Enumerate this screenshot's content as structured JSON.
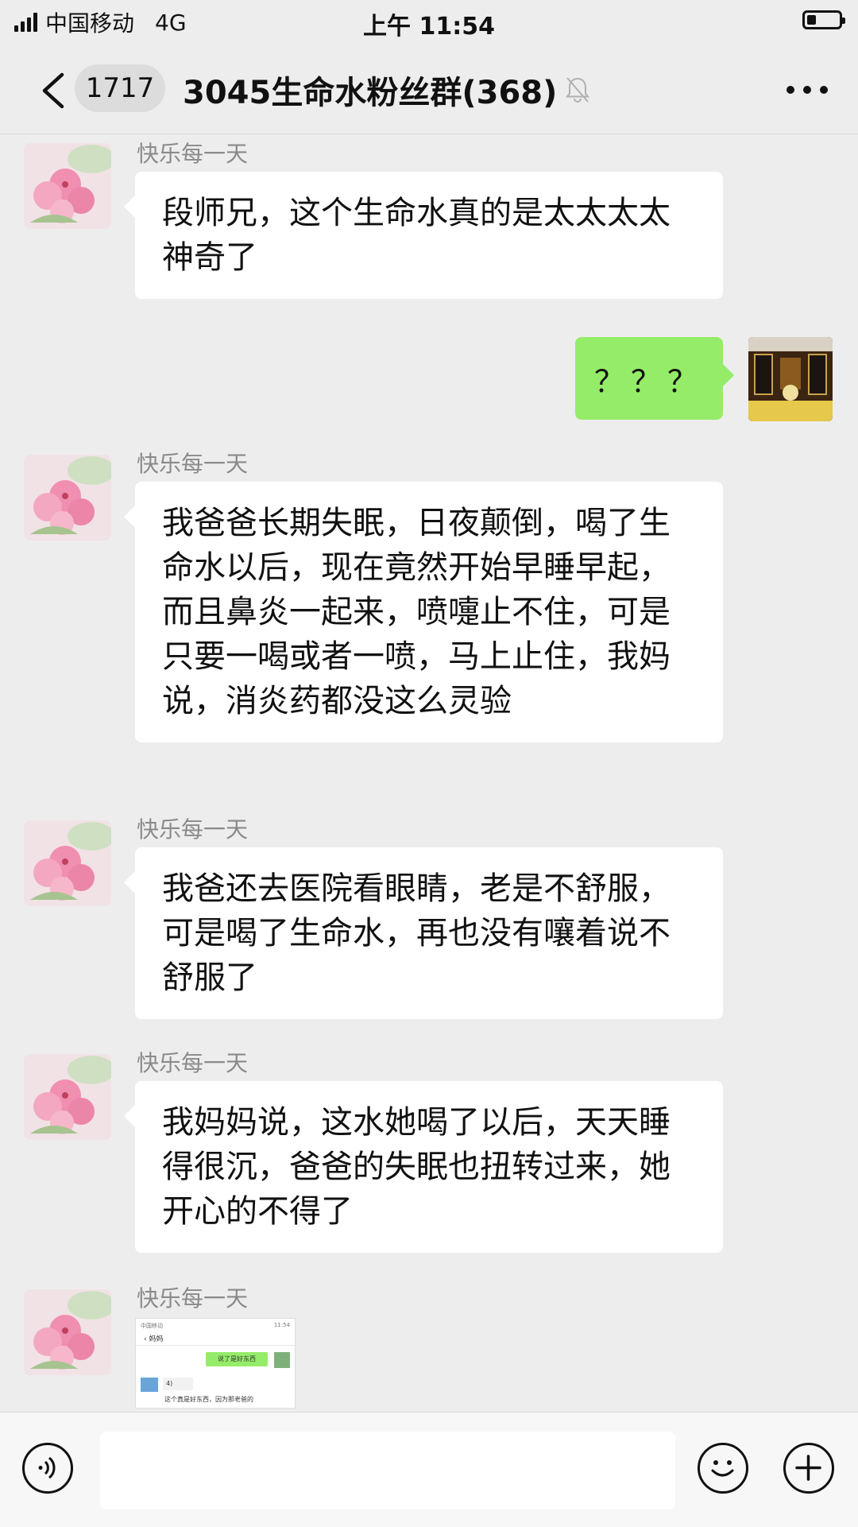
{
  "status_bar": {
    "carrier": "中国移动",
    "network": "4G",
    "time": "上午 11:54",
    "battery_level": 0.3
  },
  "header": {
    "unread_count": "1717",
    "title": "3045生命水粉丝群(368)",
    "icons": [
      "back-icon",
      "mute-bell-icon",
      "more-icon"
    ]
  },
  "messages": [
    {
      "sender": "快乐每一天",
      "text": "段师兄，这个生命水真的是太太太太神奇了"
    },
    {
      "sender": "me",
      "text": "？？？"
    },
    {
      "sender": "快乐每一天",
      "text": "我爸爸长期失眠，日夜颠倒，喝了生命水以后，现在竟然开始早睡早起，而且鼻炎一起来，喷嚏止不住，可是只要一喝或者一喷，马上止住，我妈说，消炎药都没这么灵验"
    },
    {
      "sender": "快乐每一天",
      "text": "我爸还去医院看眼睛，老是不舒服，可是喝了生命水，再也没有嚷着说不舒服了"
    },
    {
      "sender": "快乐每一天",
      "text": "我妈妈说，这水她喝了以后，天天睡得很沉，爸爸的失眠也扭转过来，她开心的不得了"
    },
    {
      "sender": "快乐每一天",
      "type": "image"
    }
  ],
  "screenshot_thumb": {
    "status_left": "中国移动",
    "status_right": "11:54",
    "title": "妈妈",
    "green_text": "说了是好东西",
    "voice": "4)",
    "text": "这个真是好东西，因为那老爸的"
  },
  "input_bar": {
    "value": "",
    "icons": [
      "voice-icon",
      "emoji-icon",
      "plus-icon"
    ]
  },
  "colors": {
    "background": "#ededed",
    "bubble_received": "#ffffff",
    "bubble_sent": "#95ec69"
  }
}
